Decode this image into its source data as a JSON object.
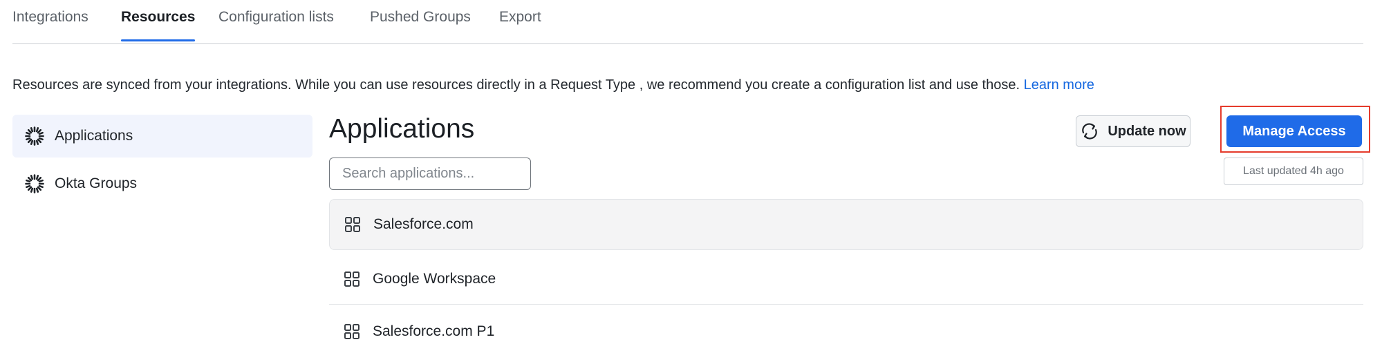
{
  "tabs": [
    {
      "label": "Integrations",
      "active": false
    },
    {
      "label": "Resources",
      "active": true
    },
    {
      "label": "Configuration lists",
      "active": false
    },
    {
      "label": "Pushed Groups",
      "active": false
    },
    {
      "label": "Export",
      "active": false
    }
  ],
  "intro": {
    "text": "Resources are synced from your integrations. While you can use resources directly in a Request Type , we recommend you create a configuration list and use those. ",
    "link": "Learn more"
  },
  "sidebar": {
    "items": [
      {
        "label": "Applications",
        "icon": "okta-icon",
        "active": true
      },
      {
        "label": "Okta Groups",
        "icon": "okta-icon",
        "active": false
      }
    ]
  },
  "main": {
    "title": "Applications",
    "update_label": "Update now",
    "manage_label": "Manage Access",
    "last_updated": "Last updated 4h ago",
    "search": {
      "placeholder": "Search applications...",
      "value": ""
    },
    "items": [
      {
        "label": "Salesforce.com",
        "icon": "grid-icon"
      },
      {
        "label": "Google Workspace",
        "icon": "grid-icon"
      },
      {
        "label": "Salesforce.com P1",
        "icon": "grid-icon"
      }
    ]
  },
  "colors": {
    "accent": "#1f6be8",
    "link": "#1668e0",
    "highlight": "#e53b2c",
    "sidebar_active_bg": "#f1f4fd"
  }
}
